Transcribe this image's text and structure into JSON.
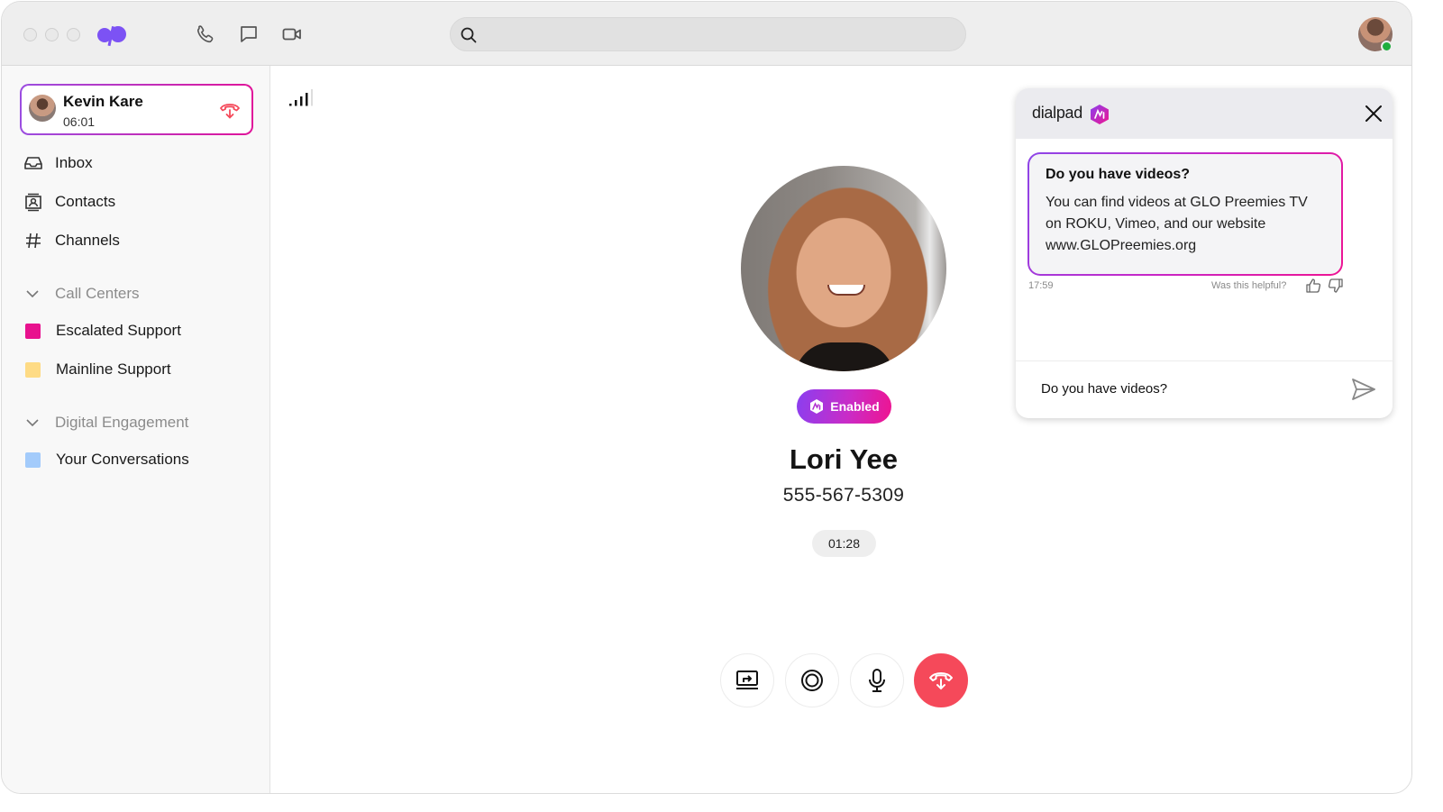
{
  "titlebar": {
    "window_controls": [
      "close",
      "minimize",
      "maximize"
    ],
    "logo": "dialpad-logo",
    "nav_icons": [
      "phone-icon",
      "message-icon",
      "video-icon"
    ],
    "search": {
      "value": "",
      "placeholder": ""
    },
    "user_status": "online"
  },
  "sidebar": {
    "active_call": {
      "name": "Kevin Kare",
      "duration": "06:01"
    },
    "nav": [
      {
        "label": "Inbox",
        "icon": "inbox-icon"
      },
      {
        "label": "Contacts",
        "icon": "contacts-icon"
      },
      {
        "label": "Channels",
        "icon": "hash-icon"
      }
    ],
    "sections": [
      {
        "label": "Call Centers",
        "items": [
          {
            "label": "Escalated Support",
            "color": "#e8128e"
          },
          {
            "label": "Mainline Support",
            "color": "#fedb85"
          }
        ]
      },
      {
        "label": "Digital Engagement",
        "items": [
          {
            "label": "Your Conversations",
            "color": "#a3cbfb"
          }
        ]
      }
    ]
  },
  "call": {
    "ai_badge": "Enabled",
    "contact_name": "Lori Yee",
    "contact_phone": "555-567-5309",
    "timer": "01:28",
    "controls": [
      "screen-share",
      "record",
      "mute",
      "hang-up"
    ],
    "signal_bars": 4
  },
  "ai_panel": {
    "brand": "dialpad",
    "message": {
      "question": "Do you have videos?",
      "answer": "You can find videos at GLO Preemies TV on ROKU, Vimeo, and our website www.GLOPreemies.org",
      "timestamp": "17:59",
      "feedback_prompt": "Was this helpful?"
    },
    "input": {
      "value": "Do you have videos?"
    }
  },
  "colors": {
    "brand_purple": "#7c52f4",
    "gradient_start": "#8a3ff0",
    "gradient_end": "#ef1490",
    "hangup_red": "#f5495a",
    "online_green": "#1fae3e"
  }
}
